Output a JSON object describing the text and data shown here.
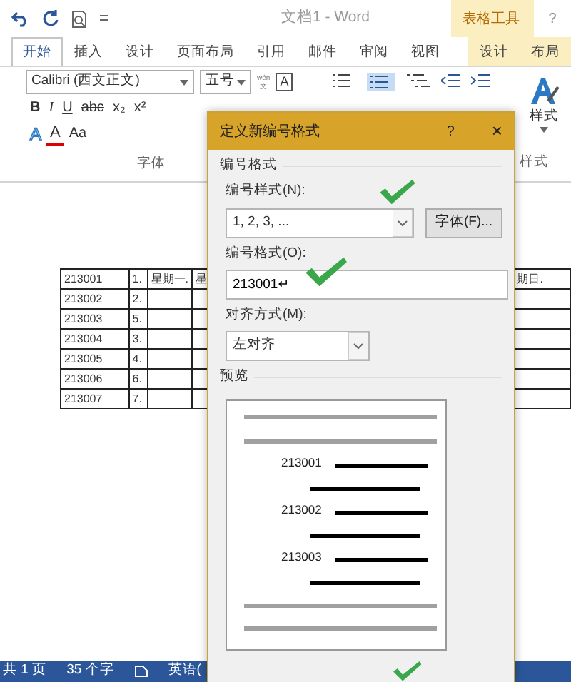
{
  "window": {
    "title": "文档1 - Word",
    "context_title": "表格工具",
    "help": "?"
  },
  "tabs": [
    {
      "label": "开始",
      "selected": true,
      "context": false
    },
    {
      "label": "插入",
      "selected": false,
      "context": false
    },
    {
      "label": "设计",
      "selected": false,
      "context": false
    },
    {
      "label": "页面布局",
      "selected": false,
      "context": false
    },
    {
      "label": "引用",
      "selected": false,
      "context": false
    },
    {
      "label": "邮件",
      "selected": false,
      "context": false
    },
    {
      "label": "审阅",
      "selected": false,
      "context": false
    },
    {
      "label": "视图",
      "selected": false,
      "context": false
    },
    {
      "label": "设计",
      "selected": false,
      "context": true
    },
    {
      "label": "布局",
      "selected": false,
      "context": true
    }
  ],
  "ribbon": {
    "font_name": "Calibri (西文正文)",
    "font_size": "五号",
    "phonetic": "wén\n文",
    "char_border": "A",
    "format_buttons": [
      {
        "label": "B",
        "kind": "bold"
      },
      {
        "label": "I",
        "kind": "italic"
      },
      {
        "label": "U",
        "kind": "underline"
      },
      {
        "label": "abc",
        "kind": "strike"
      },
      {
        "label": "x₂",
        "kind": "plain"
      },
      {
        "label": "x²",
        "kind": "plain"
      }
    ],
    "effect_buttons": [
      {
        "label": "A",
        "kind": "outline"
      },
      {
        "label": "A",
        "kind": "color"
      },
      {
        "label": "Aa",
        "kind": "plain"
      }
    ],
    "font_group": "字体",
    "styles_button": "样式",
    "styles_group": "样式"
  },
  "table": {
    "rows": [
      [
        "213001",
        "1.",
        "星期一.",
        "星",
        "期日."
      ],
      [
        "213002",
        "2.",
        "",
        "",
        ""
      ],
      [
        "213003",
        "5.",
        "",
        "",
        ""
      ],
      [
        "213004",
        "3.",
        "",
        "",
        ""
      ],
      [
        "213005",
        "4.",
        "",
        "",
        ""
      ],
      [
        "213006",
        "6.",
        "",
        "",
        ""
      ],
      [
        "213007",
        "7.",
        "",
        "",
        ""
      ]
    ]
  },
  "dialog": {
    "title": "定义新编号格式",
    "help": "?",
    "close": "×",
    "section": "编号格式",
    "style_label": "编号样式(N):",
    "style_value": "1, 2, 3, ...",
    "font_button": "字体(F)...",
    "format_label": "编号格式(O):",
    "format_value": "213001↵",
    "align_label": "对齐方式(M):",
    "align_value": "左对齐",
    "preview_label": "预览",
    "preview_items": [
      "213001",
      "213002",
      "213003"
    ]
  },
  "status_bar": {
    "items": [
      "共 1 页",
      "35 个字",
      "英语("
    ]
  }
}
